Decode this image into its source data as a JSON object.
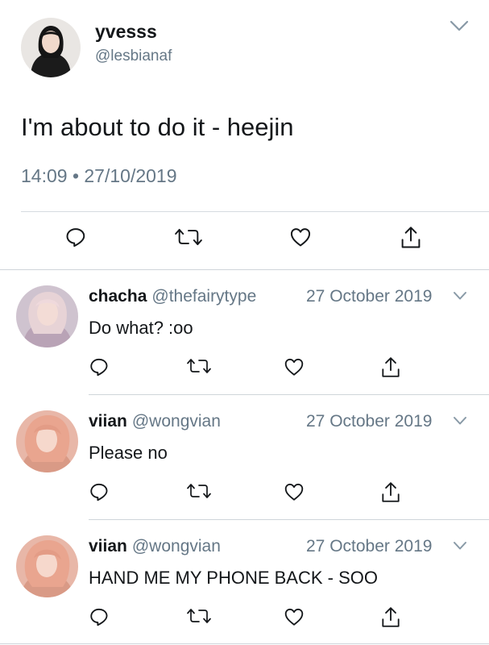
{
  "main_tweet": {
    "display_name": "yvesss",
    "handle": "@lesbianaf",
    "text": "I'm about to do it - heejin",
    "timestamp": "14:09 • 27/10/2019"
  },
  "replies": [
    {
      "display_name": "chacha",
      "handle": "@thefairytype",
      "date": "27 October 2019",
      "text": "Do what? :oo"
    },
    {
      "display_name": "viian",
      "handle": "@wongvian",
      "date": "27 October 2019",
      "text": "Please no"
    },
    {
      "display_name": "viian",
      "handle": "@wongvian",
      "date": "27 October 2019",
      "text": "HAND ME MY PHONE BACK - SOO"
    }
  ],
  "icons": {
    "reply": "reply-icon",
    "retweet": "retweet-icon",
    "like": "heart-icon",
    "share": "share-icon",
    "more": "chevron-down-icon"
  },
  "colors": {
    "text": "#14171a",
    "secondary": "#657786",
    "icon": "#14171a",
    "divider": "#d6dbe0"
  }
}
